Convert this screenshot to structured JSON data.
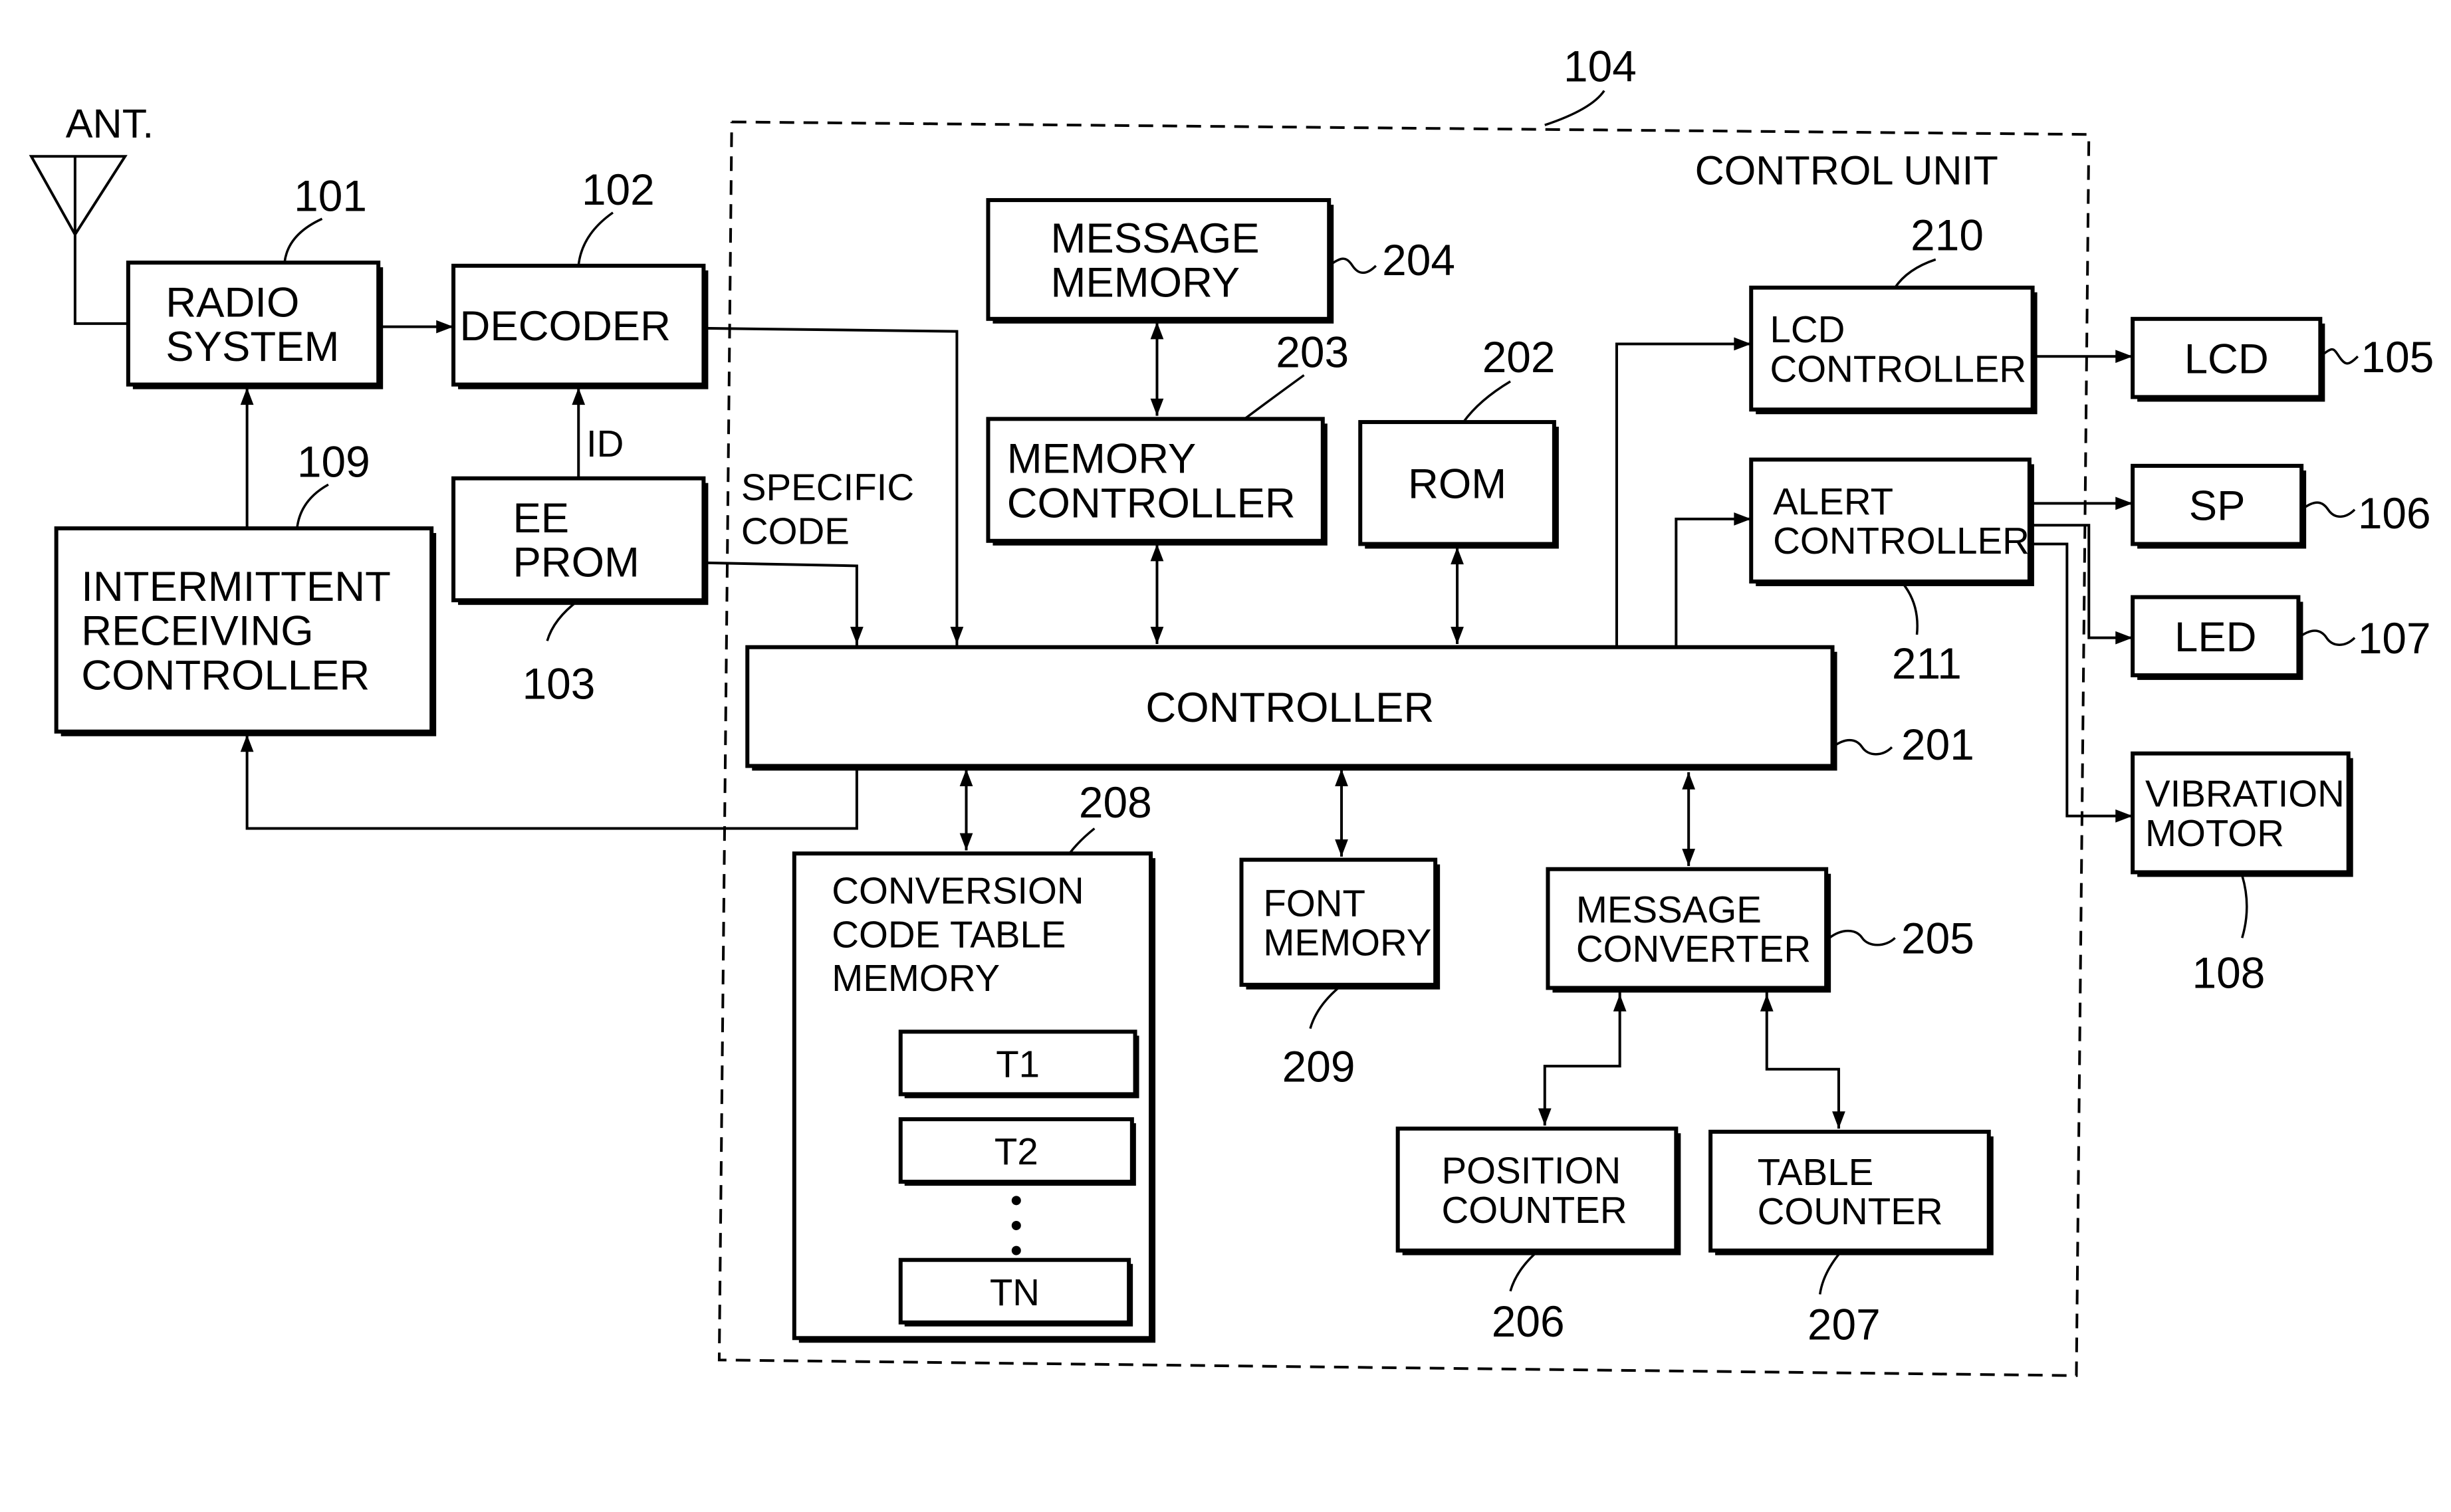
{
  "diagram": {
    "antenna_label": "ANT.",
    "control_unit": {
      "ref": "104",
      "label": "CONTROL UNIT"
    },
    "blocks": {
      "radio_system": {
        "ref": "101",
        "lines": [
          "RADIO",
          "SYSTEM"
        ]
      },
      "decoder": {
        "ref": "102",
        "lines": [
          "DECODER"
        ]
      },
      "eeprom": {
        "ref": "103",
        "lines": [
          "EE",
          "PROM"
        ]
      },
      "intermittent": {
        "ref": "109",
        "lines": [
          "INTERMITTENT",
          "RECEIVING",
          "CONTROLLER"
        ]
      },
      "controller": {
        "ref": "201",
        "lines": [
          "CONTROLLER"
        ]
      },
      "rom": {
        "ref": "202",
        "lines": [
          "ROM"
        ]
      },
      "memory_ctrl": {
        "ref": "203",
        "lines": [
          "MEMORY",
          "CONTROLLER"
        ]
      },
      "message_memory": {
        "ref": "204",
        "lines": [
          "MESSAGE",
          "MEMORY"
        ]
      },
      "message_conv": {
        "ref": "205",
        "lines": [
          "MESSAGE",
          "CONVERTER"
        ]
      },
      "position_ctr": {
        "ref": "206",
        "lines": [
          "POSITION",
          "COUNTER"
        ]
      },
      "table_ctr": {
        "ref": "207",
        "lines": [
          "TABLE",
          "COUNTER"
        ]
      },
      "conv_table": {
        "ref": "208",
        "lines": [
          "CONVERSION",
          "CODE  TABLE",
          "MEMORY"
        ]
      },
      "font_memory": {
        "ref": "209",
        "lines": [
          "FONT",
          "MEMORY"
        ]
      },
      "lcd_ctrl": {
        "ref": "210",
        "lines": [
          "LCD",
          "CONTROLLER"
        ]
      },
      "alert_ctrl": {
        "ref": "211",
        "lines": [
          "ALERT",
          "CONTROLLER"
        ]
      },
      "lcd": {
        "ref": "105",
        "lines": [
          "LCD"
        ]
      },
      "sp": {
        "ref": "106",
        "lines": [
          "SP"
        ]
      },
      "led": {
        "ref": "107",
        "lines": [
          "LED"
        ]
      },
      "vibration": {
        "ref": "108",
        "lines": [
          "VIBRATION",
          "MOTOR"
        ]
      }
    },
    "tables": [
      "T1",
      "T2",
      "TN"
    ],
    "signals": {
      "id": "ID",
      "specific_code": [
        "SPECIFIC",
        "CODE"
      ]
    }
  }
}
